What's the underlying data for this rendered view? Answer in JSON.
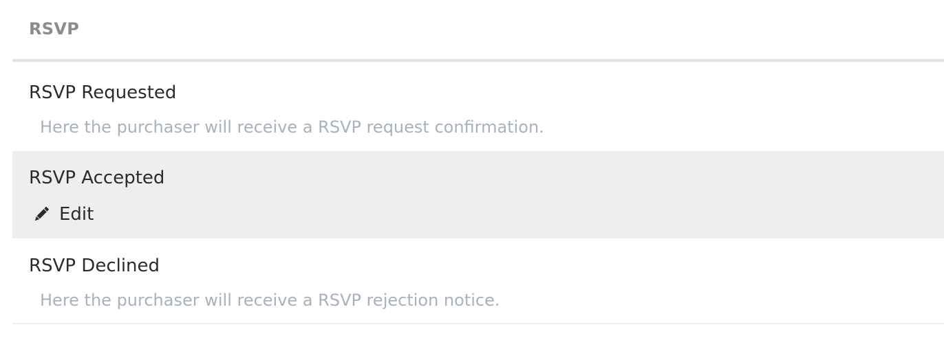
{
  "header": {
    "title": "RSVP"
  },
  "rows": [
    {
      "title": "RSVP Requested",
      "description": "Here the purchaser will receive a RSVP request confirmation."
    },
    {
      "title": "RSVP Accepted",
      "action_label": "Edit",
      "action_icon": "pencil-icon"
    },
    {
      "title": "RSVP Declined",
      "description": "Here the purchaser will receive a RSVP rejection notice."
    }
  ],
  "colors": {
    "header_text": "#8c8c8c",
    "title_text": "#2b2b2b",
    "description_text": "#a9b2ba",
    "active_row_bg": "#eeeeee"
  }
}
